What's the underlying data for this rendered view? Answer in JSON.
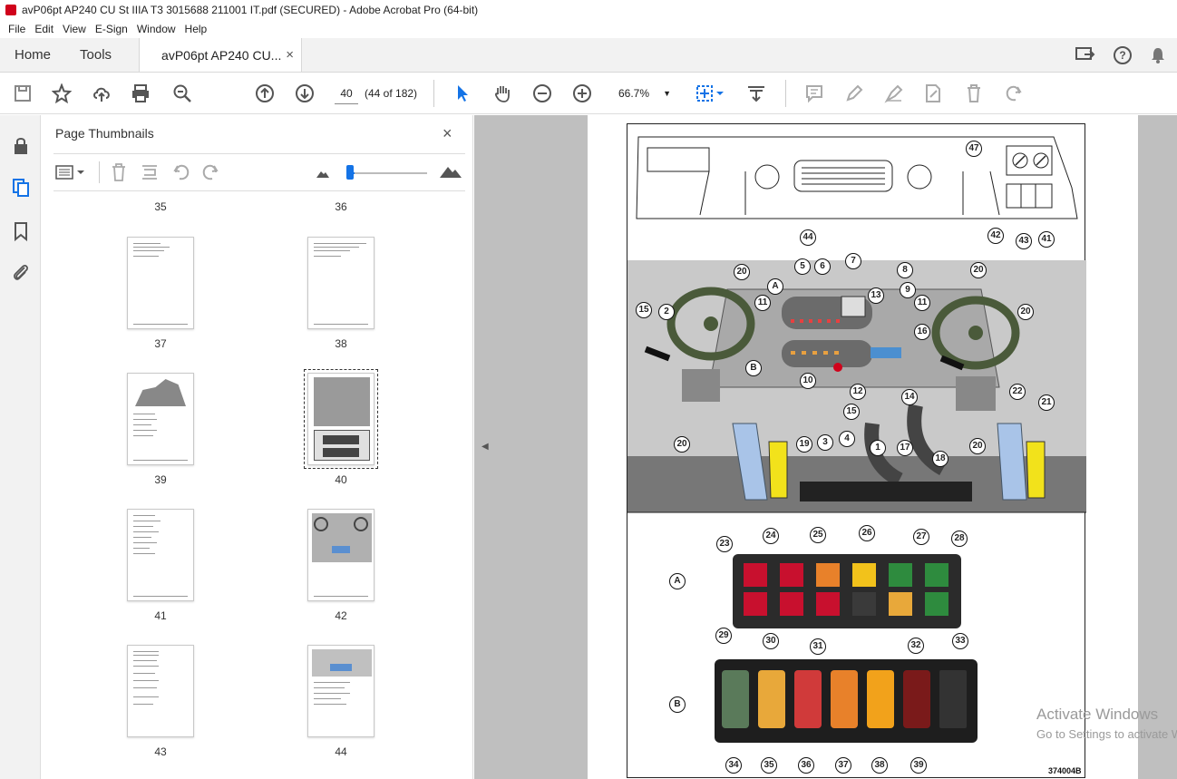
{
  "window": {
    "title": "avP06pt AP240 CU St IIIA T3 3015688 211001 IT.pdf (SECURED) - Adobe Acrobat Pro (64-bit)"
  },
  "menu": [
    "File",
    "Edit",
    "View",
    "E-Sign",
    "Window",
    "Help"
  ],
  "tabs": {
    "home": "Home",
    "tools": "Tools",
    "document": "avP06pt AP240 CU...",
    "close": "×"
  },
  "toolbar": {
    "page_value": "40",
    "page_count": "(44 of 182)",
    "zoom": "66.7%"
  },
  "panel": {
    "title": "Page Thumbnails",
    "close": "×",
    "thumbnails": [
      {
        "label": "35"
      },
      {
        "label": "36"
      },
      {
        "label": "37"
      },
      {
        "label": "38"
      },
      {
        "label": "39"
      },
      {
        "label": "40",
        "selected": true
      },
      {
        "label": "41"
      },
      {
        "label": "42"
      },
      {
        "label": "43"
      },
      {
        "label": "44"
      }
    ]
  },
  "document": {
    "callouts_top": [
      "47",
      "44",
      "42",
      "43",
      "41"
    ],
    "callouts_middle": [
      "20",
      "5",
      "6",
      "7",
      "8",
      "20",
      "A",
      "11",
      "13",
      "9",
      "11",
      "20",
      "15",
      "2",
      "16",
      "B",
      "10",
      "12",
      "14",
      "22",
      "21",
      "15",
      "19",
      "3",
      "4",
      "1",
      "17",
      "18",
      "20",
      "20"
    ],
    "panel_a_label": "A",
    "panel_a_callouts": [
      "23",
      "24",
      "25",
      "26",
      "27",
      "28",
      "29",
      "30",
      "31",
      "32",
      "33"
    ],
    "panel_b_label": "B",
    "panel_b_callouts": [
      "34",
      "35",
      "36",
      "37",
      "38",
      "39"
    ],
    "figure_code": "374004B"
  },
  "watermark": {
    "line1": "Activate Windows",
    "line2": "Go to Settings to activate Windows."
  },
  "colors": {
    "accent": "#1473e6",
    "pdf_red": "#d0021b",
    "switch_red": "#c8102e",
    "switch_green": "#2e8b3e",
    "switch_orange": "#e8812a",
    "switch_yellow": "#f2c21b"
  }
}
